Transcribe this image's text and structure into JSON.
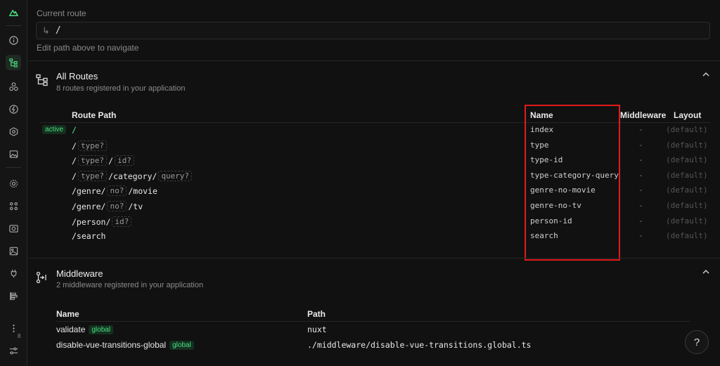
{
  "colors": {
    "accent": "#4ade80",
    "highlight": "#e21b1b"
  },
  "sidebar": {
    "icons": [
      "nuxt-logo-icon",
      "info-icon",
      "routes-icon",
      "components-icon",
      "lightning-icon",
      "modules-icon",
      "image-icon",
      "settings-icon",
      "plugins-icon",
      "camera-icon",
      "assets-icon",
      "plug-icon",
      "timeline-icon",
      "more-icon",
      "sliders-icon"
    ],
    "more_count": "8"
  },
  "route_nav": {
    "label": "Current route",
    "value": "/",
    "hint": "Edit path above to navigate"
  },
  "routes_section": {
    "title": "All Routes",
    "subtitle": "8 routes registered in your application",
    "headers": {
      "path": "Route Path",
      "name": "Name",
      "middleware": "Middleware",
      "layout": "Layout"
    },
    "active_label": "active",
    "rows": [
      {
        "parts": [
          {
            "t": "seg",
            "v": "/"
          }
        ],
        "name": "index",
        "middleware": "-",
        "layout": "(default)"
      },
      {
        "parts": [
          {
            "t": "seg",
            "v": "/"
          },
          {
            "t": "param",
            "v": "type?"
          }
        ],
        "name": "type",
        "middleware": "-",
        "layout": "(default)"
      },
      {
        "parts": [
          {
            "t": "seg",
            "v": "/"
          },
          {
            "t": "param",
            "v": "type?"
          },
          {
            "t": "seg",
            "v": "/"
          },
          {
            "t": "param",
            "v": "id?"
          }
        ],
        "name": "type-id",
        "middleware": "-",
        "layout": "(default)"
      },
      {
        "parts": [
          {
            "t": "seg",
            "v": "/"
          },
          {
            "t": "param",
            "v": "type?"
          },
          {
            "t": "seg",
            "v": "/category/"
          },
          {
            "t": "param",
            "v": "query?"
          }
        ],
        "name": "type-category-query",
        "middleware": "-",
        "layout": "(default)"
      },
      {
        "parts": [
          {
            "t": "seg",
            "v": "/genre/"
          },
          {
            "t": "param",
            "v": "no?"
          },
          {
            "t": "seg",
            "v": "/movie"
          }
        ],
        "name": "genre-no-movie",
        "middleware": "-",
        "layout": "(default)"
      },
      {
        "parts": [
          {
            "t": "seg",
            "v": "/genre/"
          },
          {
            "t": "param",
            "v": "no?"
          },
          {
            "t": "seg",
            "v": "/tv"
          }
        ],
        "name": "genre-no-tv",
        "middleware": "-",
        "layout": "(default)"
      },
      {
        "parts": [
          {
            "t": "seg",
            "v": "/person/"
          },
          {
            "t": "param",
            "v": "id?"
          }
        ],
        "name": "person-id",
        "middleware": "-",
        "layout": "(default)"
      },
      {
        "parts": [
          {
            "t": "seg",
            "v": "/search"
          }
        ],
        "name": "search",
        "middleware": "-",
        "layout": "(default)"
      }
    ]
  },
  "middleware_section": {
    "title": "Middleware",
    "subtitle": "2 middleware registered in your application",
    "headers": {
      "name": "Name",
      "path": "Path"
    },
    "rows": [
      {
        "name": "validate",
        "tag": "global",
        "path": "nuxt"
      },
      {
        "name": "disable-vue-transitions-global",
        "tag": "global",
        "path": "./middleware/disable-vue-transitions.global.ts"
      }
    ]
  },
  "help_label": "?"
}
